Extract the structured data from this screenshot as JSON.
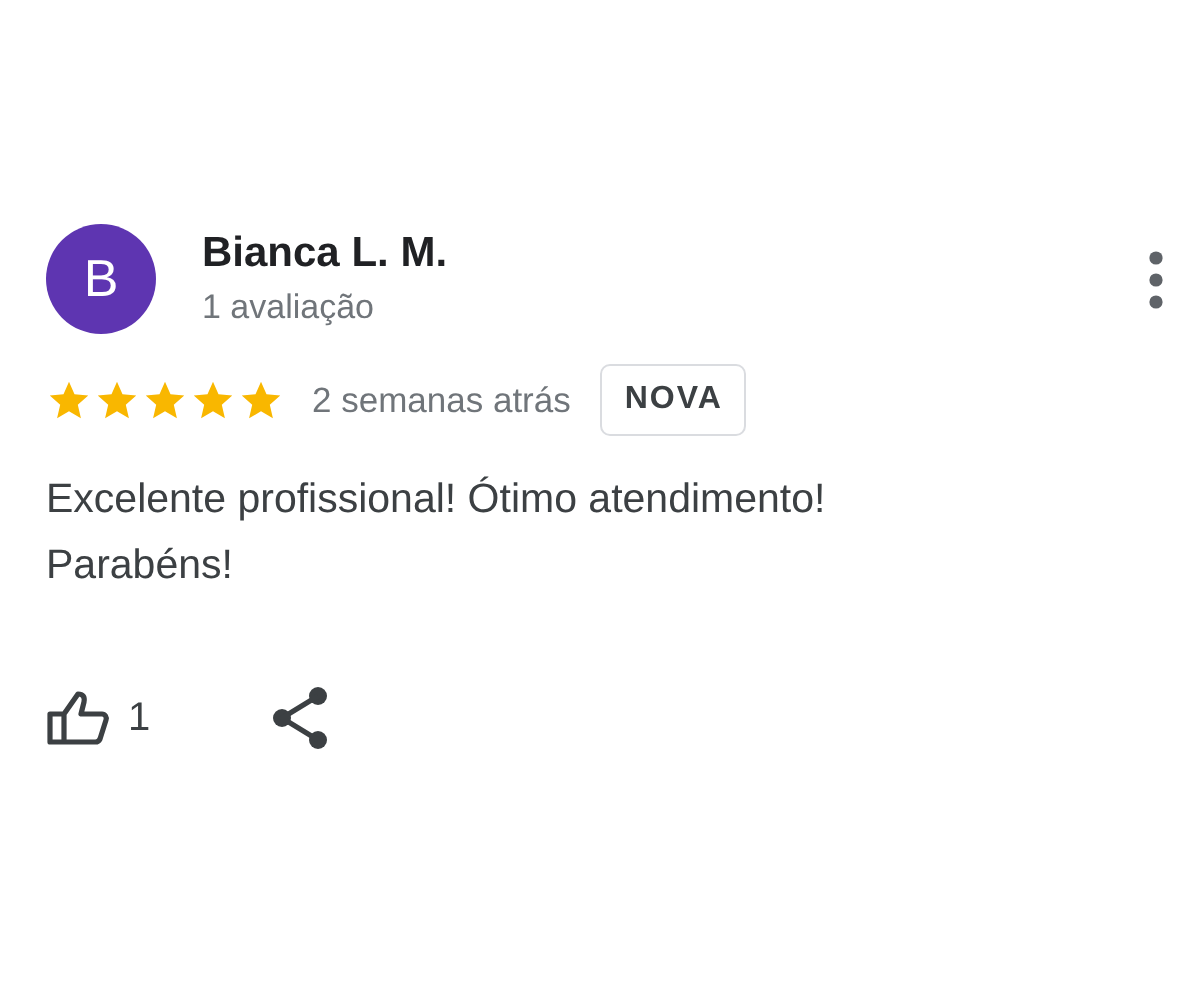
{
  "review": {
    "avatar": {
      "letter": "B",
      "color": "#5e35b1"
    },
    "author": "Bianca L. M.",
    "review_count": "1 avaliação",
    "stars": 5,
    "time": "2 semanas atrás",
    "badge": "NOVA",
    "text": "Excelente profissional! Ótimo atendimento! Parabéns!",
    "likes": "1"
  }
}
